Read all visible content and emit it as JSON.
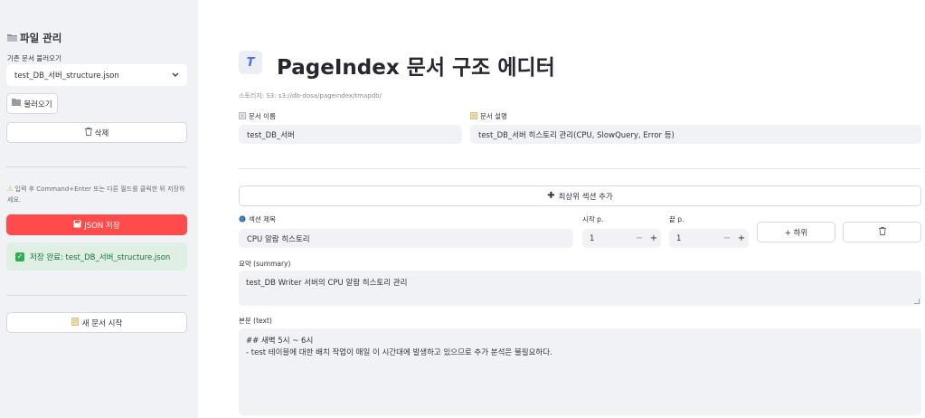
{
  "sidebar": {
    "title_icon": "folder-icon",
    "title": "파일 관리",
    "load_label": "기존 문서 불러오기",
    "selected_file": "test_DB_서버_structure.json",
    "load_button": "불러오기",
    "delete_button": "삭제",
    "warning": "입력 후 Command+Enter 또는 다른 필드를 클릭한 뒤 저장하세요.",
    "save_button": "JSON 저장",
    "success_message": "저장 완료: test_DB_서버_structure.json",
    "new_doc_button": "새 문서 시작",
    "accent_color": "#ff4b4b"
  },
  "main": {
    "title": "PageIndex 문서 구조 에디터",
    "storage": "스토리지: S3: s3://db-dosa/pageindex/tmapdb/",
    "doc_name_label": "문서 이름",
    "doc_name_value": "test_DB_서버",
    "doc_desc_label": "문서 설명",
    "doc_desc_value": "test_DB_서버 히스토리 관리(CPU, SlowQuery, Error 등)",
    "add_section_button": "최상위 섹션 추가",
    "section": {
      "title_label": "섹션 제목",
      "title_value": "CPU 알람 히스토리",
      "start_label": "시작 p.",
      "start_value": "1",
      "end_label": "끝 p.",
      "end_value": "1",
      "sub_button": "+ 하위",
      "summary_label": "요약 (summary)",
      "summary_value": "test_DB Writer 서버의 CPU 알람 히스토리 관리",
      "text_label": "본문 (text)",
      "text_line1": "## 새벽 5시 ~ 6시",
      "text_line2": "- test 테이블에 대한 배치 작업이 매일 이 시간대에 발생하고 있으므로 추가 분석은 불필요하다."
    }
  }
}
